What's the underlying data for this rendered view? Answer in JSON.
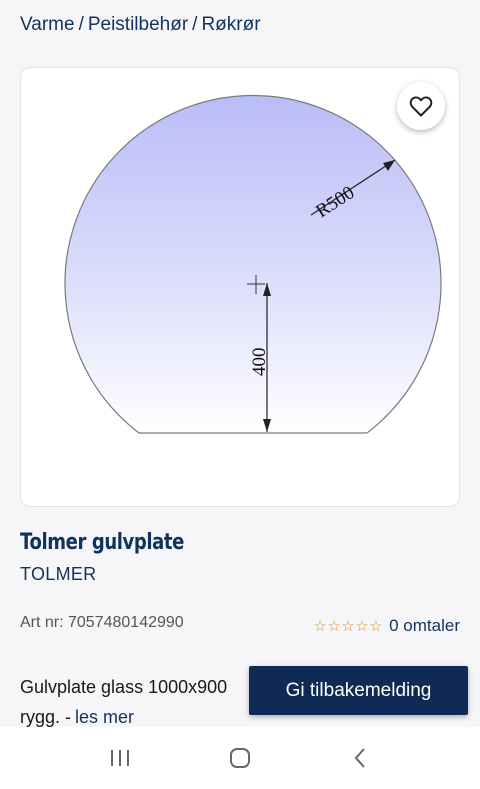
{
  "breadcrumb": {
    "items": [
      "Varme",
      "Peistilbehør",
      "Røkrør"
    ],
    "separator": "/"
  },
  "product": {
    "image_labels": {
      "radius": "R500",
      "height": "400"
    },
    "title": "Tolmer gulvplate",
    "brand": "TOLMER",
    "article_number": "Art nr: 7057480142990",
    "rating": {
      "stars": "☆☆☆☆☆",
      "reviews_label": "0 omtaler"
    },
    "description_line1": "Gulvplate glass 1000x900",
    "description_line2": "rygg. -",
    "read_more": "les mer"
  },
  "feedback_button": {
    "label": "Gi tilbakemelding"
  },
  "colors": {
    "primary": "#12325e",
    "button": "#0e2a55",
    "star": "#d98a3c",
    "glass_fill": "#c9ccf7"
  },
  "icons": {
    "favorite": "heart-outline-icon",
    "nav_recents": "recents-icon",
    "nav_home": "home-icon",
    "nav_back": "back-icon"
  }
}
